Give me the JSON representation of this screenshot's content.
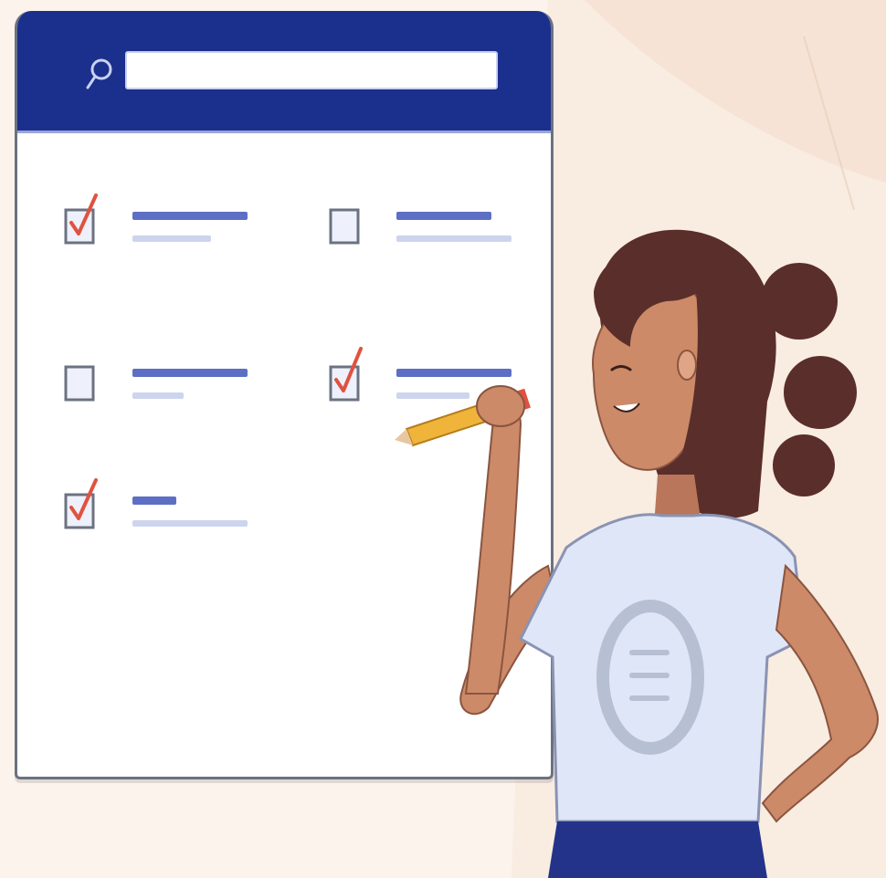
{
  "search": {
    "placeholder": "",
    "value": ""
  },
  "checklist": {
    "items": [
      {
        "checked": true
      },
      {
        "checked": false
      },
      {
        "checked": false
      },
      {
        "checked": true
      },
      {
        "checked": true
      }
    ]
  },
  "colors": {
    "header": "#1b2f8c",
    "accent_line": "#5d6fc4",
    "muted_line": "#cdd4ee",
    "checkmark": "#e0523f",
    "checkbox_border": "#6b7280",
    "hair": "#5a2e2a",
    "skin": "#cc8a68",
    "shirt": "#dfe6f7",
    "pencil": "#f0b43a"
  },
  "icons": [
    "search-icon",
    "checkbox-checked-icon",
    "checkbox-empty-icon",
    "pencil-icon",
    "chat-bubble-icon"
  ]
}
